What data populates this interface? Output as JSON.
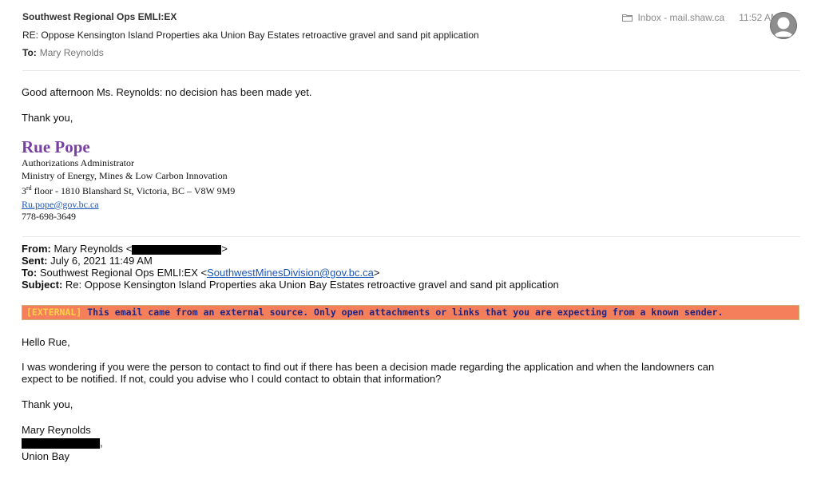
{
  "email": {
    "sender": "Southwest Regional Ops EMLI:EX",
    "subject": "RE: Oppose Kensington Island Properties aka Union Bay Estates retroactive gravel and sand pit application",
    "to_label": "To:",
    "to_value": "Mary  Reynolds",
    "folder": "Inbox - mail.shaw.ca",
    "time": "11:52 AM"
  },
  "body": {
    "greeting": "Good afternoon Ms. Reynolds: no decision has been made yet.",
    "thanks": "Thank you,"
  },
  "signature": {
    "name": "Rue Pope",
    "title": "Authorizations Administrator",
    "ministry": "Ministry of Energy, Mines & Low Carbon Innovation",
    "floor_num": "3",
    "floor_sup": "rd",
    "address": " floor - 1810 Blanshard St, Victoria, BC – V8W 9M9",
    "email": "Ru.pope@gov.bc.ca",
    "phone": "778-698-3649"
  },
  "quoted": {
    "from_label": "From:",
    "from_value": "Mary Reynolds <",
    "from_close": ">",
    "sent_label": "Sent:",
    "sent_value": "July 6, 2021 11:49 AM",
    "to_label": "To:",
    "to_value": "Southwest Regional Ops EMLI:EX <",
    "to_email": "SouthwestMinesDivision@gov.bc.ca",
    "to_close": ">",
    "subject_label": "Subject:",
    "subject_value": "Re: Oppose Kensington Island Properties aka Union Bay Estates retroactive gravel and sand pit application"
  },
  "warning": {
    "tag": "[EXTERNAL]",
    "text": "This email came from an external source. Only open attachments or links that you are expecting from a known sender."
  },
  "message": {
    "greeting": "Hello Rue,",
    "line1": "I was wondering if you were the person to contact to find out if there has been a decision made regarding the application and when the landowners can",
    "line2": "expect to be notified.  If not, could you advise who I could contact to obtain that information?",
    "thanks": "Thank you,",
    "name": "Mary Reynolds",
    "comma": ",",
    "location": "Union Bay"
  }
}
